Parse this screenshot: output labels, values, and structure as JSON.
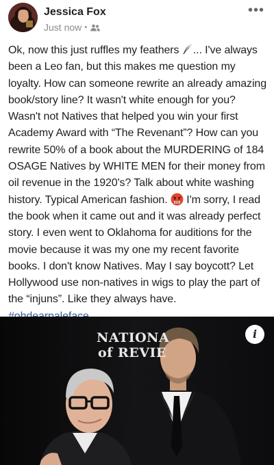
{
  "post": {
    "author": "Jessica Fox",
    "timestamp": "Just now",
    "privacy_icon": "friends-icon",
    "more_label": "•••",
    "text": {
      "p1_a": "Ok, now this just ruffles my feathers ",
      "p1_b": "... I've always been a Leo fan, but this makes me question my loyalty. How can someone rewrite an already amazing book/story line? It wasn't white enough for you? Wasn't not Natives that helped you win your first Academy Award with “The Revenant”? How can you rewrite 50% of a book about the MURDERING of 184 OSAGE Natives by WHITE MEN for their money from oil revenue in the 1920's? Talk about white washing history. Typical American fashion. ",
      "p1_c": " I'm sorry, I read the book when it came out and it was already perfect story. I even went to Oklahoma for auditions for the movie because it was my one my recent favorite books. I don't know Natives. May I say boycott? Let Hollywood use non-natives in wigs to play the part of the “injuns”. Like they always have.",
      "hashtag": "#ohdearpaleface"
    },
    "emojis": [
      "feather-emoji",
      "angry-face-emoji"
    ],
    "photo": {
      "backdrop_line1": "NATIONA",
      "backdrop_line2": "of REVIE",
      "info_label": "i"
    }
  }
}
